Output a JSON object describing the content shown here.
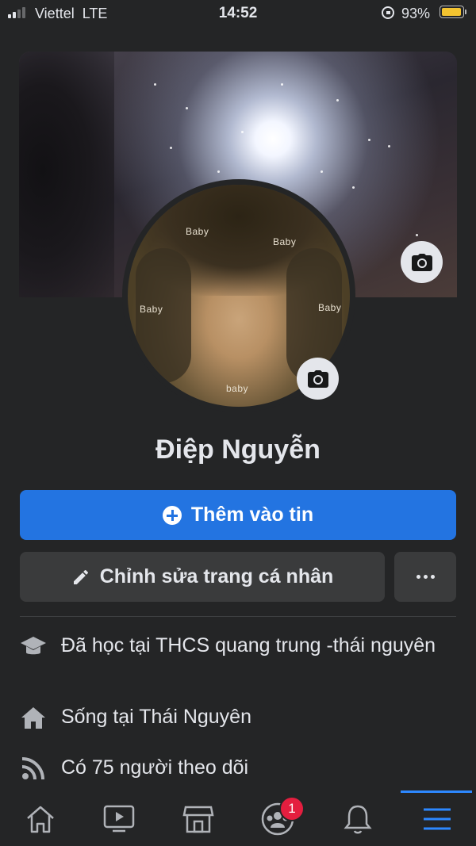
{
  "status_bar": {
    "carrier": "Viettel",
    "network": "LTE",
    "time": "14:52",
    "battery_percent": "93%",
    "battery_level": 0.93,
    "signal_bars": 2
  },
  "profile": {
    "name": "Điệp Nguyễn",
    "photo_labels": [
      "Baby",
      "Baby",
      "Baby",
      "Baby",
      "baby"
    ]
  },
  "actions": {
    "add_story_label": "Thêm vào tin",
    "edit_profile_label": "Chỉnh sửa trang cá nhân",
    "more_label": "..."
  },
  "details": {
    "education_prefix": "Đã học tại ",
    "education_place": "THCS quang trung -thái nguyên",
    "lives_prefix": "Sống tại ",
    "lives_place": "Thái Nguyên",
    "followers_text": "Có 75 người theo dõi"
  },
  "bottom_nav": {
    "items": [
      "home-icon",
      "watch-icon",
      "marketplace-icon",
      "groups-icon",
      "notifications-icon",
      "menu-icon"
    ],
    "groups_badge": "1",
    "active": "menu-icon"
  },
  "colors": {
    "background": "#242526",
    "primary_button": "#2374e1",
    "secondary_button": "#3a3b3c",
    "text": "#e4e6eb",
    "badge": "#e41e3f",
    "active_tab": "#2d88ff"
  }
}
